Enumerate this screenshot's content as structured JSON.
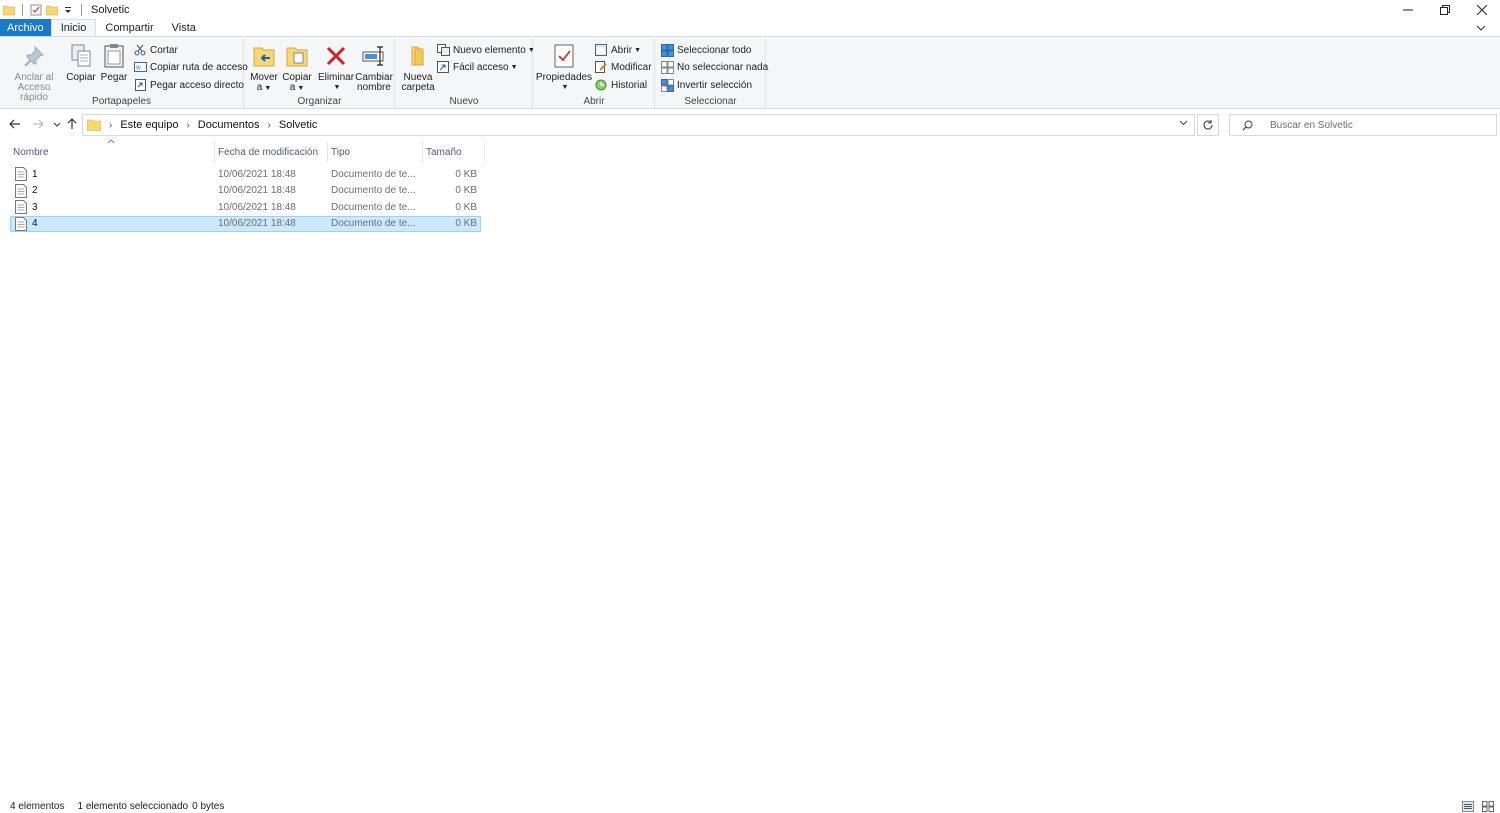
{
  "window": {
    "title": "Solvetic"
  },
  "tabs": [
    {
      "label": "Archivo"
    },
    {
      "label": "Inicio"
    },
    {
      "label": "Compartir"
    },
    {
      "label": "Vista"
    }
  ],
  "ribbon": {
    "portapapeles": {
      "label": "Portapapeles",
      "pin_label_1": "Anclar al",
      "pin_label_2": "Acceso rápido",
      "copy": "Copiar",
      "paste": "Pegar",
      "cut": "Cortar",
      "copy_path": "Copiar ruta de acceso",
      "paste_shortcut": "Pegar acceso directo"
    },
    "organizar": {
      "label": "Organizar",
      "move_1": "Mover",
      "move_2": "a",
      "copyto_1": "Copiar",
      "copyto_2": "a",
      "delete": "Eliminar",
      "rename_1": "Cambiar",
      "rename_2": "nombre"
    },
    "nuevo": {
      "label": "Nuevo",
      "new_folder_1": "Nueva",
      "new_folder_2": "carpeta",
      "new_item": "Nuevo elemento",
      "easy_access": "Fácil acceso"
    },
    "abrir": {
      "label": "Abrir",
      "properties": "Propiedades",
      "open": "Abrir",
      "edit": "Modificar",
      "history": "Historial"
    },
    "seleccionar": {
      "label": "Seleccionar",
      "select_all": "Seleccionar todo",
      "select_none": "No seleccionar nada",
      "invert": "Invertir selección"
    }
  },
  "address": {
    "crumbs": [
      "Este equipo",
      "Documentos",
      "Solvetic"
    ],
    "search_placeholder": "Buscar en Solvetic"
  },
  "columns": [
    "Nombre",
    "Fecha de modificación",
    "Tipo",
    "Tamaño"
  ],
  "files": [
    {
      "name": "1",
      "date": "10/06/2021 18:48",
      "type": "Documento de te...",
      "size": "0 KB"
    },
    {
      "name": "2",
      "date": "10/06/2021 18:48",
      "type": "Documento de te...",
      "size": "0 KB"
    },
    {
      "name": "3",
      "date": "10/06/2021 18:48",
      "type": "Documento de te...",
      "size": "0 KB"
    },
    {
      "name": "4",
      "date": "10/06/2021 18:48",
      "type": "Documento de te...",
      "size": "0 KB"
    }
  ],
  "status": {
    "count": "4 elementos",
    "selected": "1 elemento seleccionado",
    "bytes": "0 bytes"
  },
  "colors": {
    "file_tab": "#1979ca",
    "selection": "#cce8ff",
    "folder": "#f8d775",
    "delete_red": "#d32020"
  }
}
